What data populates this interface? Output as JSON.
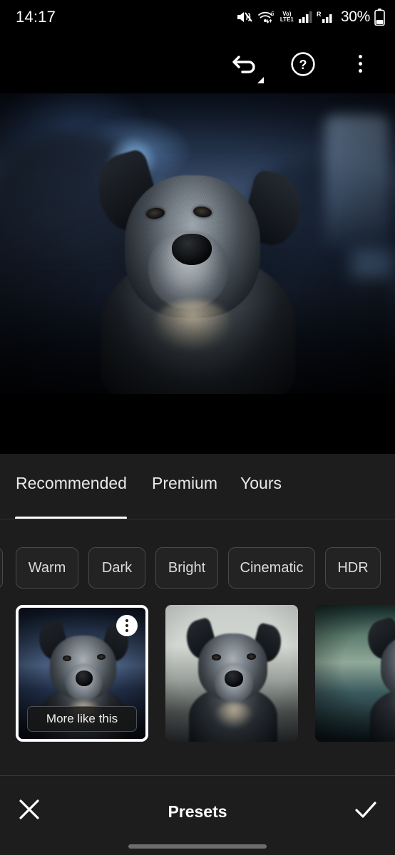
{
  "status_bar": {
    "time": "14:17",
    "battery_percent": "30%",
    "icons": [
      "mute-icon",
      "wifi-6-icon",
      "volte-icon",
      "signal-icon",
      "roaming-icon",
      "battery-icon"
    ],
    "volte_top": "Vo)",
    "volte_bottom": "LTE1",
    "wifi_badge": "6",
    "roaming_badge": "R"
  },
  "toolbar": {
    "undo_label": "undo-icon",
    "help_label": "?",
    "menu_label": "more-options-icon"
  },
  "photo": {
    "alt": "Australian cattle dog sitting on a dark couch, blue toned edit"
  },
  "tabs": [
    {
      "label": "Recommended",
      "active": true
    },
    {
      "label": "Premium",
      "active": false
    },
    {
      "label": "Yours",
      "active": false
    }
  ],
  "chips": [
    {
      "label": "Warm"
    },
    {
      "label": "Dark"
    },
    {
      "label": "Bright"
    },
    {
      "label": "Cinematic"
    },
    {
      "label": "HDR"
    }
  ],
  "presets": [
    {
      "name": "preset-1",
      "selected": true,
      "more_like_this": "More like this",
      "tone": "blue"
    },
    {
      "name": "preset-2",
      "selected": false,
      "tone": "bright"
    },
    {
      "name": "preset-3",
      "selected": false,
      "tone": "green"
    }
  ],
  "bottom_bar": {
    "title": "Presets",
    "cancel": "close-icon",
    "confirm": "check-icon"
  },
  "colors": {
    "panel_bg": "#1d1d1d",
    "page_bg": "#000000",
    "accent": "#ffffff",
    "chip_border": "#4a4a4a",
    "chip_bg": "#232323"
  }
}
